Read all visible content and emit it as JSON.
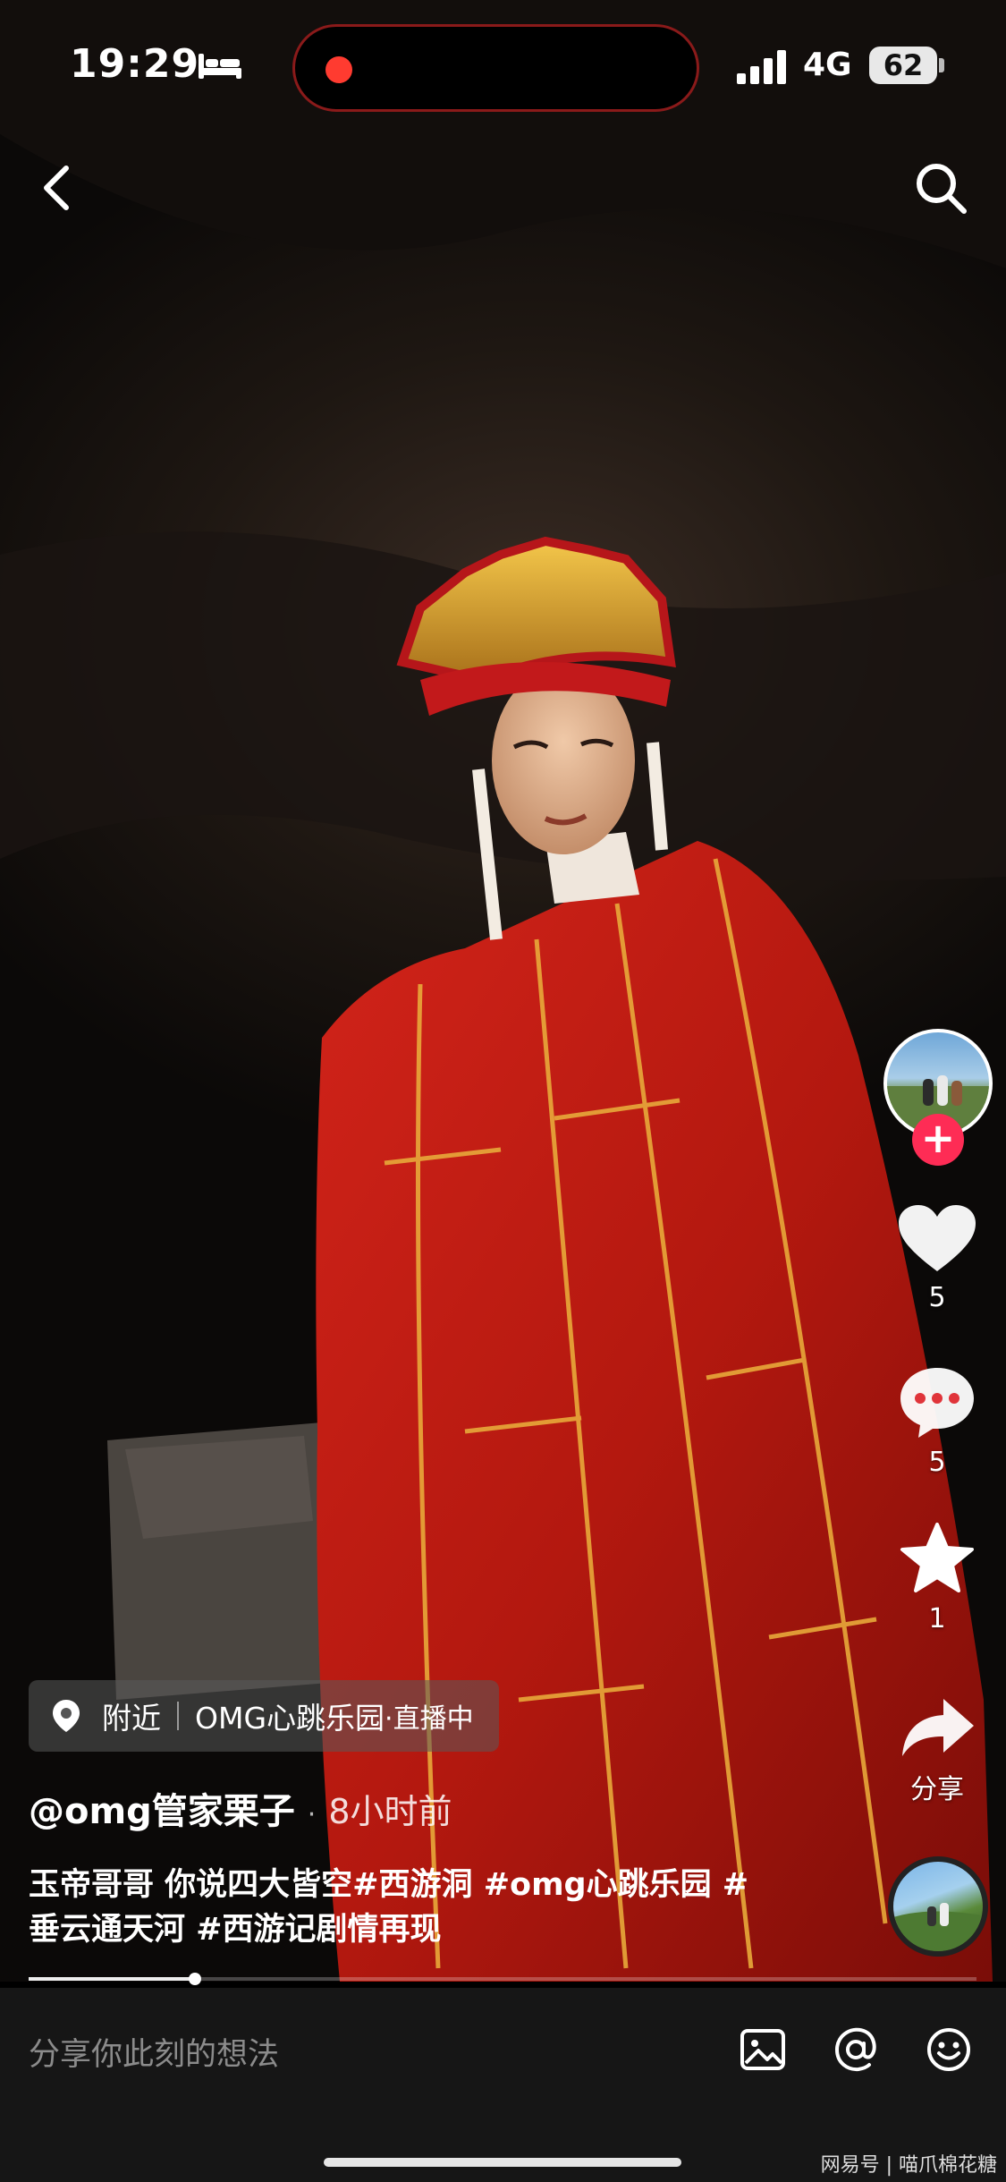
{
  "status_bar": {
    "time": "19:29",
    "network": "4G",
    "battery": "62",
    "recording_dot_color": "#ff3b30"
  },
  "nav": {
    "back_icon": "chevron-left-icon",
    "search_icon": "search-icon"
  },
  "right_rail": {
    "like_count": "5",
    "comment_count": "5",
    "favorite_count": "1",
    "share_label": "分享",
    "follow_color": "#fe2c55"
  },
  "location": {
    "label": "附近",
    "place": "OMG心跳乐园",
    "status": "·直播中"
  },
  "post": {
    "author": "@omg管家栗子",
    "separator": "·",
    "time_ago": "8小时前",
    "caption_line1": "玉帝哥哥 你说四大皆空#西游洞 #omg心跳乐园 #",
    "caption_line2": "垂云通天河 #西游记剧情再现"
  },
  "playback": {
    "progress_fraction": 0.175
  },
  "comment_bar": {
    "placeholder": "分享你此刻的想法",
    "image_icon": "image-icon",
    "mention_icon": "at-icon",
    "emoji_icon": "emoji-icon"
  },
  "watermark": "网易号 | 喵爪棉花糖"
}
